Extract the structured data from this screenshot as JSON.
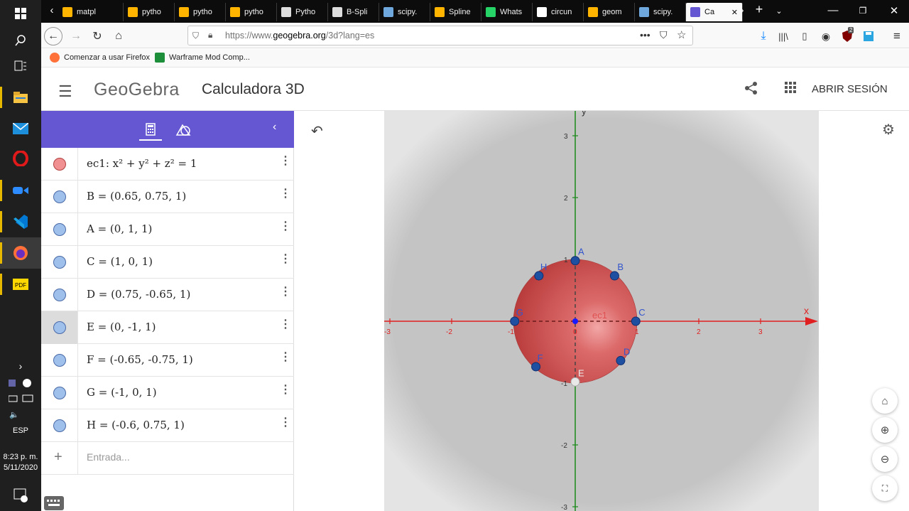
{
  "taskbar": {
    "time": "8:23 p. m.",
    "date": "5/11/2020",
    "language": "ESP",
    "notification_count": "1"
  },
  "browser": {
    "tabs": [
      {
        "label": "matpl",
        "icon": "matplotlib-icon"
      },
      {
        "label": "pytho",
        "icon": "python-icon"
      },
      {
        "label": "pytho",
        "icon": "python-icon"
      },
      {
        "label": "pytho",
        "icon": "python-icon"
      },
      {
        "label": "Pytho",
        "icon": "book-icon"
      },
      {
        "label": "B-Spli",
        "icon": "book-icon"
      },
      {
        "label": "scipy.",
        "icon": "scipy-icon"
      },
      {
        "label": "Spline",
        "icon": "python-icon"
      },
      {
        "label": "Whats",
        "icon": "whatsapp-icon"
      },
      {
        "label": "circun",
        "icon": "google-icon"
      },
      {
        "label": "geom",
        "icon": "python-icon"
      },
      {
        "label": "scipy.",
        "icon": "scipy-icon"
      },
      {
        "label": "Ca",
        "icon": "geogebra-icon",
        "active": true
      }
    ],
    "url_prefix": "https://www.",
    "url_host": "geogebra.org",
    "url_rest": "/3d?lang=es",
    "addon_badge": "2",
    "bookmarks": [
      {
        "label": "Comenzar a usar Firefox",
        "icon": "firefox-icon"
      },
      {
        "label": "Warframe Mod Comp...",
        "icon": "spreadsheet-icon"
      }
    ]
  },
  "app": {
    "logo": "GeoGebra",
    "title": "Calculadora 3D",
    "login": "ABRIR SESIÓN"
  },
  "algebra": {
    "items": [
      {
        "expr": "ec1: x² + y² + z² = 1",
        "color": "#f19090"
      },
      {
        "expr": "B = (0.65, 0.75, 1)",
        "color": "#9fc0ea"
      },
      {
        "expr": "A = (0, 1, 1)",
        "color": "#9fc0ea"
      },
      {
        "expr": "C = (1, 0, 1)",
        "color": "#9fc0ea"
      },
      {
        "expr": "D = (0.75, -0.65, 1)",
        "color": "#9fc0ea"
      },
      {
        "expr": "E = (0, -1, 1)",
        "color": "#9fc0ea",
        "selected": true
      },
      {
        "expr": "F = (-0.65, -0.75, 1)",
        "color": "#9fc0ea"
      },
      {
        "expr": "G = (-1, 0, 1)",
        "color": "#9fc0ea"
      },
      {
        "expr": "H = (-0.6, 0.75, 1)",
        "color": "#9fc0ea"
      }
    ],
    "input_placeholder": "Entrada..."
  },
  "graphics": {
    "axis_x_label": "x",
    "axis_y_label": "y",
    "x_ticks": [
      "-3",
      "-2",
      "-1",
      "0",
      "1",
      "2",
      "3"
    ],
    "y_ticks": [
      "3",
      "2",
      "1",
      "-1",
      "-2",
      "-3"
    ],
    "sphere_label": "ec1",
    "sphere_color": "#cc4444",
    "axis_x_color": "#e02020",
    "axis_y_color": "#1a8a1a",
    "points": [
      {
        "name": "A",
        "x": 0,
        "y": 1
      },
      {
        "name": "B",
        "x": 0.65,
        "y": 0.75
      },
      {
        "name": "C",
        "x": 1,
        "y": 0
      },
      {
        "name": "D",
        "x": 0.75,
        "y": -0.65
      },
      {
        "name": "E",
        "x": 0,
        "y": -1
      },
      {
        "name": "F",
        "x": -0.65,
        "y": -0.75
      },
      {
        "name": "G",
        "x": -1,
        "y": 0
      },
      {
        "name": "H",
        "x": -0.6,
        "y": 0.75
      }
    ]
  }
}
